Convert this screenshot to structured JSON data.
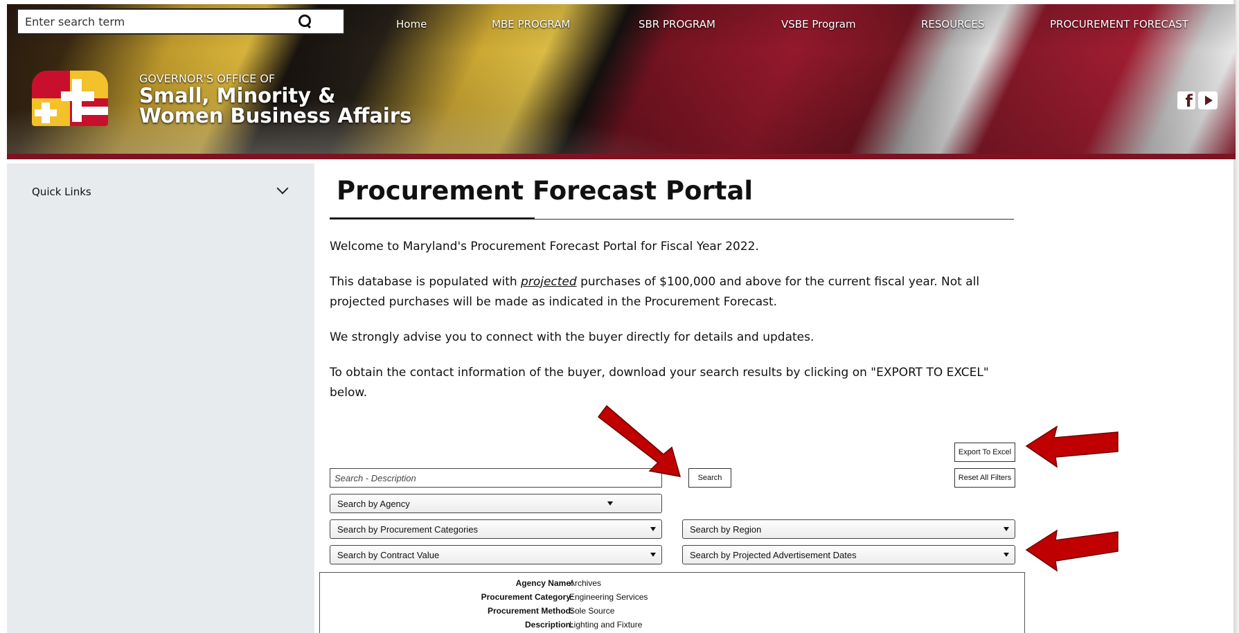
{
  "header": {
    "search_placeholder": "Enter search term",
    "nav": [
      "Home",
      "MBE PROGRAM",
      "SBR PROGRAM",
      "VSBE Program",
      "RESOURCES",
      "PROCUREMENT FORECAST"
    ],
    "org_top": "GOVERNOR'S OFFICE OF",
    "org_line1": "Small, Minority &",
    "org_line2": "Women Business Affairs",
    "social": [
      "facebook-icon",
      "youtube-icon"
    ]
  },
  "sidebar": {
    "quick_links": "Quick Links"
  },
  "main": {
    "title": "Procurement Forecast Portal",
    "p1": "Welcome to Maryland's Procurement Forecast Portal for Fiscal Year 2022.",
    "p2_before": "This database is populated with ",
    "p2_em": "projected",
    "p2_after": " purchases of $100,000 and above for the current fiscal year. Not all projected purchases will be made as indicated in the Procurement Forecast.",
    "p3": "We strongly advise you to connect with the buyer directly for details and updates.",
    "p4": "To obtain the contact information of the buyer, download your search results by clicking on \"EXPORT TO EXCEL\" below."
  },
  "filters": {
    "description_placeholder": "Search - Description",
    "search_button": "Search",
    "export_button": "Export To Excel",
    "reset_button": "Reset All Filters",
    "agency": "Search by Agency",
    "categories": "Search by Procurement Categories",
    "region": "Search by Region",
    "contract_value": "Search by Contract Value",
    "ad_dates": "Search by Projected Advertisement Dates"
  },
  "result": [
    {
      "label": "Agency Name:",
      "value": "Archives"
    },
    {
      "label": "Procurement Category:",
      "value": "Engineering Services"
    },
    {
      "label": "Procurement Method:",
      "value": "Sole Source"
    },
    {
      "label": "Description:",
      "value": "Lighting and Fixture"
    }
  ],
  "colors": {
    "annotation_arrow": "#c00000",
    "banner_red": "#9b1a2e",
    "banner_gold": "#e3bd3e"
  }
}
